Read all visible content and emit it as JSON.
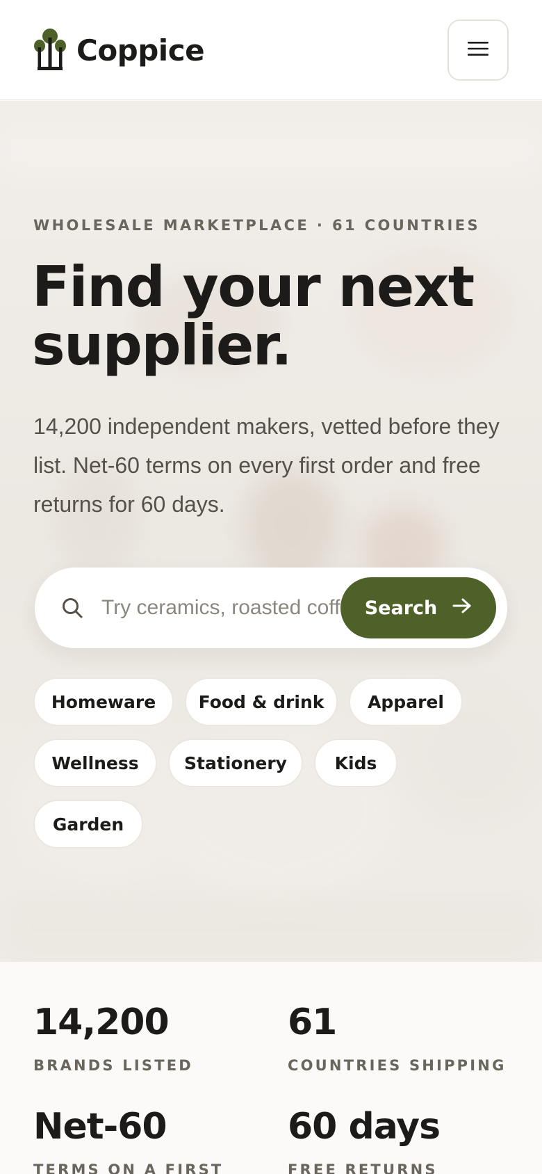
{
  "header": {
    "brand": "Coppice",
    "logo_icon": "tree-logo-icon",
    "menu_icon": "hamburger-menu-icon"
  },
  "hero": {
    "eyebrow": "WHOLESALE MARKETPLACE · 61 COUNTRIES",
    "headline": "Find your next supplier.",
    "lede": "14,200 independent makers, vetted before they list. Net-60 terms on every first order and free returns for 60 days.",
    "search": {
      "placeholder": "Try ceramics, roasted coffee",
      "value": "",
      "button_label": "Search",
      "button_icon": "arrow-right-icon",
      "search_icon": "search-icon"
    },
    "categories": [
      "Homeware",
      "Food & drink",
      "Apparel",
      "Wellness",
      "Stationery",
      "Kids",
      "Garden"
    ]
  },
  "stats": [
    {
      "value": "14,200",
      "label": "BRANDS LISTED"
    },
    {
      "value": "61",
      "label": "COUNTRIES SHIPPING"
    },
    {
      "value": "Net-60",
      "label": "TERMS ON A FIRST"
    },
    {
      "value": "60 days",
      "label": "FREE RETURNS"
    }
  ],
  "colors": {
    "accent": "#4e6128",
    "text": "#1c1b19",
    "muted": "#6a655d",
    "hero_bg": "#eeebe6"
  }
}
